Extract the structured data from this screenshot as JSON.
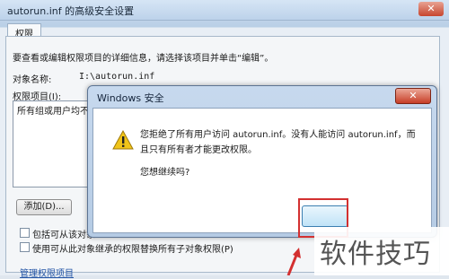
{
  "background_window": {
    "title": "autorun.inf 的高级安全设置",
    "close_label": "✕",
    "tab": "权限",
    "description": "要查看或编辑权限项目的详细信息，请选择该项目并单击“编辑”。",
    "object_name_label": "对象名称:",
    "object_name_value": "I:\\autorun.inf",
    "permission_items_label": "权限项目(I):",
    "list_first_item": "所有组或用户均不",
    "add_button": "添加(D)...",
    "checkbox_inherit": "包括可从该对象",
    "checkbox_replace": "使用可从此对象继承的权限替换所有子对象权限(P)",
    "link": "管理权限项目"
  },
  "dialog": {
    "title": "Windows 安全",
    "close_label": "✕",
    "message": "您拒绝了所有用户访问 autorun.inf。没有人能访问 autorun.inf，而且只有所有者才能更改权限。",
    "question": "您想继续吗?",
    "ok_button": ""
  },
  "watermark": "软件技巧",
  "colors": {
    "dialog_frame": "#b5cbe4",
    "close_red": "#c73d26",
    "highlight": "#d33030",
    "warning_yellow": "#f0c419"
  }
}
